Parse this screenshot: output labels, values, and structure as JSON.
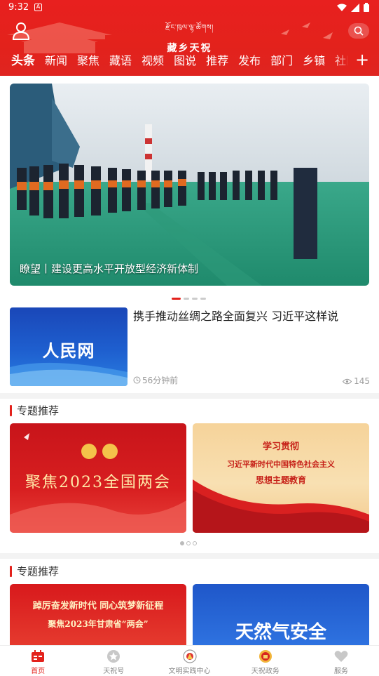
{
  "statusbar": {
    "time": "9:32",
    "notif": "A"
  },
  "app": {
    "tibetan_name": "རྫོང་ཁུལ་ལྷ་ཚོགས།",
    "name": "藏乡天祝"
  },
  "tabs": [
    {
      "label": "头条",
      "active": true
    },
    {
      "label": "新闻"
    },
    {
      "label": "聚焦"
    },
    {
      "label": "藏语"
    },
    {
      "label": "视频"
    },
    {
      "label": "图说"
    },
    {
      "label": "推荐"
    },
    {
      "label": "发布"
    },
    {
      "label": "部门"
    },
    {
      "label": "乡镇"
    },
    {
      "label": "社区"
    }
  ],
  "hero": {
    "caption": "瞭望丨建设更高水平开放型经济新体制",
    "page_count": 4,
    "current_page": 1
  },
  "news": {
    "thumb_text": "人民网",
    "title": "携手推动丝绸之路全面复兴  习近平这样说",
    "time": "56分钟前",
    "views": "145"
  },
  "section1": {
    "title": "专题推荐",
    "cards": [
      {
        "text": "聚焦2023全国两会"
      },
      {
        "line1": "学习贯彻",
        "line2": "习近平新时代中国特色社会主义",
        "line3": "思想主题教育"
      }
    ]
  },
  "section2": {
    "title": "专题推荐",
    "cards": [
      {
        "line1": "踔厉奋发新时代 同心筑梦新征程",
        "line2": "聚焦2023年甘肃省“两会”"
      },
      {
        "text": "天然气安全"
      }
    ]
  },
  "bottom_nav": [
    {
      "label": "首页",
      "icon": "calendar-icon",
      "active": true
    },
    {
      "label": "天祝号",
      "icon": "star-icon"
    },
    {
      "label": "文明实践中心",
      "icon": "emblem-icon"
    },
    {
      "label": "天祝政务",
      "icon": "gov-emblem-icon"
    },
    {
      "label": "服务",
      "icon": "heart-icon"
    }
  ],
  "colors": {
    "brand_red": "#e3221c",
    "thumb_blue": "#1e5fcf"
  }
}
